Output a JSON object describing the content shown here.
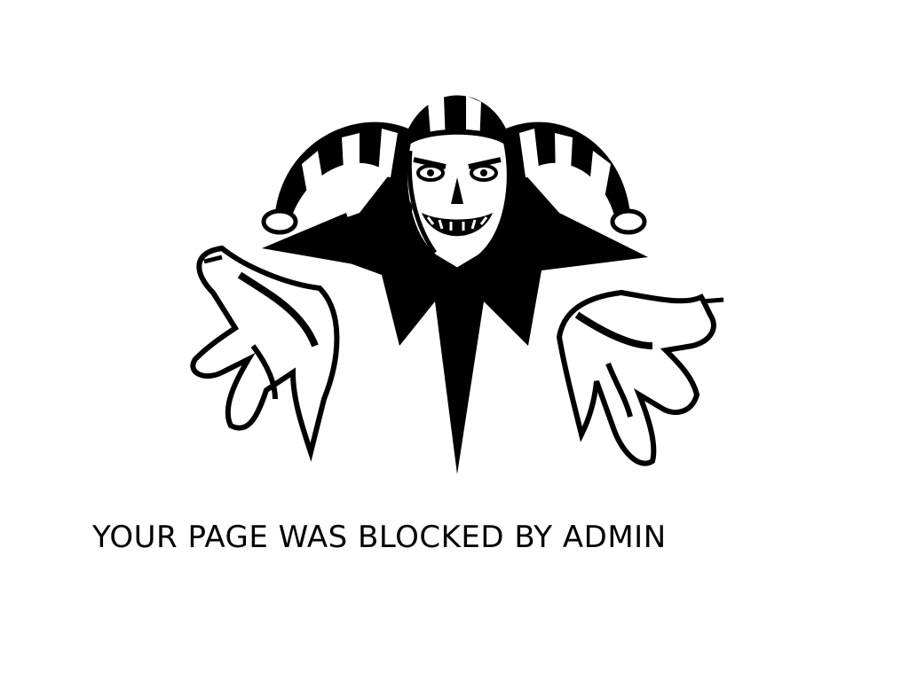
{
  "message": {
    "text": "YOUR PAGE WAS BLOCKED BY ADMIN"
  },
  "illustration": {
    "icon": "jester-icon",
    "ink_color": "#000000",
    "paper_color": "#ffffff"
  }
}
